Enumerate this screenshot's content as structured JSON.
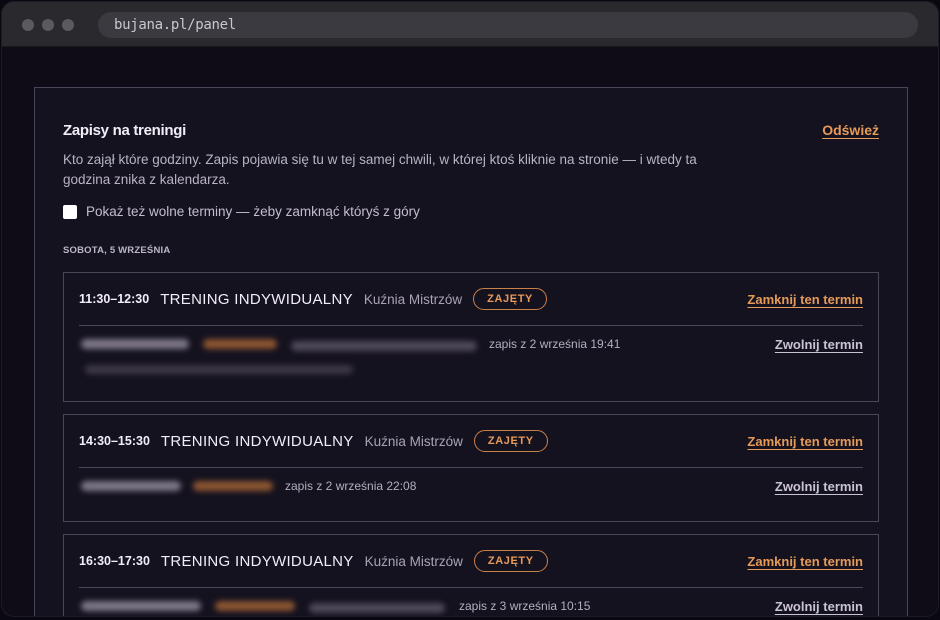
{
  "browser": {
    "url": "bujana.pl/panel"
  },
  "panel": {
    "title": "Zapisy na treningi",
    "refresh_label": "Odśwież",
    "description": "Kto zajął które godziny. Zapis pojawia się tu w tej samej chwili, w której ktoś kliknie na stronie — i wtedy ta godzina znika z kalendarza.",
    "show_free_label": "Pokaż też wolne terminy — żeby zamknąć któryś z góry",
    "show_free_checked": false,
    "day_heading": "SOBOTA, 5 WRZEŚNIA"
  },
  "slots": [
    {
      "time": "11:30–12:30",
      "type": "TRENING INDYWIDUALNY",
      "place": "Kuźnia Mistrzów",
      "status": "ZAJĘTY",
      "close_label": "Zamknij ten termin",
      "signup": "zapis z 2 września 19:41",
      "release_label": "Zwolnij termin"
    },
    {
      "time": "14:30–15:30",
      "type": "TRENING INDYWIDUALNY",
      "place": "Kuźnia Mistrzów",
      "status": "ZAJĘTY",
      "close_label": "Zamknij ten termin",
      "signup": "zapis z 2 września 22:08",
      "release_label": "Zwolnij termin"
    },
    {
      "time": "16:30–17:30",
      "type": "TRENING INDYWIDUALNY",
      "place": "Kuźnia Mistrzów",
      "status": "ZAJĘTY",
      "close_label": "Zamknij ten termin",
      "signup": "zapis z 3 września 10:15",
      "release_label": "Zwolnij termin"
    }
  ],
  "colors": {
    "accent": "#e69a58",
    "background": "#15121f",
    "border": "#4a4558"
  }
}
